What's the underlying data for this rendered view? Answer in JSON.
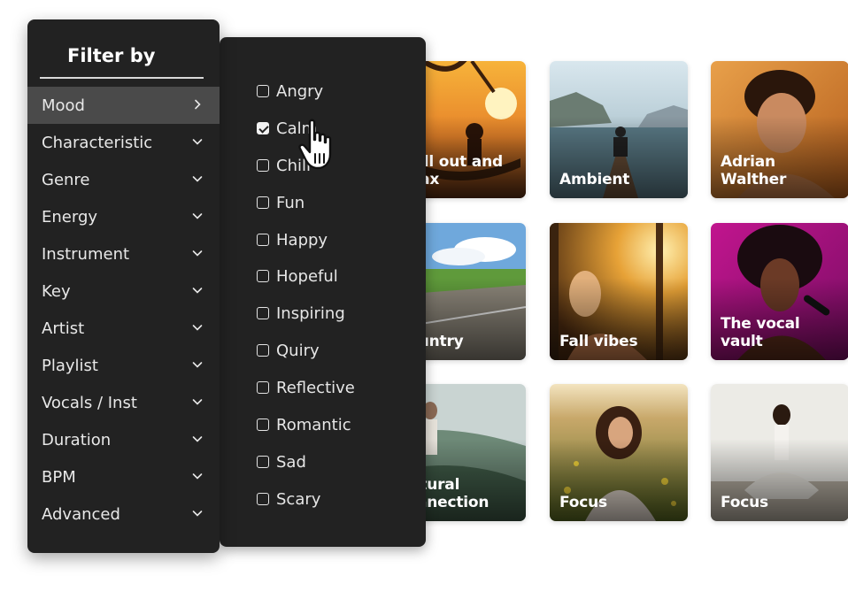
{
  "filter_panel": {
    "title": "Filter by",
    "items": [
      {
        "label": "Mood",
        "active": true,
        "chevron": "chevron-right-icon"
      },
      {
        "label": "Characteristic",
        "chevron": "chevron-down-icon"
      },
      {
        "label": "Genre",
        "chevron": "chevron-down-icon"
      },
      {
        "label": "Energy",
        "chevron": "chevron-down-icon"
      },
      {
        "label": "Instrument",
        "chevron": "chevron-down-icon"
      },
      {
        "label": "Key",
        "chevron": "chevron-down-icon"
      },
      {
        "label": "Artist",
        "chevron": "chevron-down-icon"
      },
      {
        "label": "Playlist",
        "chevron": "chevron-down-icon"
      },
      {
        "label": "Vocals / Inst",
        "chevron": "chevron-down-icon"
      },
      {
        "label": "Duration",
        "chevron": "chevron-down-icon"
      },
      {
        "label": "BPM",
        "chevron": "chevron-down-icon"
      },
      {
        "label": "Advanced",
        "chevron": "chevron-down-icon"
      }
    ]
  },
  "mood_options": [
    {
      "label": "Angry",
      "checked": false
    },
    {
      "label": "Calm",
      "checked": true
    },
    {
      "label": "Chill",
      "checked": false
    },
    {
      "label": "Fun",
      "checked": false
    },
    {
      "label": "Happy",
      "checked": false
    },
    {
      "label": "Hopeful",
      "checked": false
    },
    {
      "label": "Inspiring",
      "checked": false
    },
    {
      "label": "Quiry",
      "checked": false
    },
    {
      "label": "Reflective",
      "checked": false
    },
    {
      "label": "Romantic",
      "checked": false
    },
    {
      "label": "Sad",
      "checked": false
    },
    {
      "label": "Scary",
      "checked": false
    }
  ],
  "tiles": [
    {
      "title": "Chill out and\nrelax"
    },
    {
      "title": "Ambient"
    },
    {
      "title": "Adrian\nWalther"
    },
    {
      "title": "Country"
    },
    {
      "title": "Fall vibes"
    },
    {
      "title": "The vocal\nvault"
    },
    {
      "title": "Natural\nconnection"
    },
    {
      "title": "Focus"
    },
    {
      "title": "Focus"
    }
  ],
  "colors": {
    "panel_bg": "#222222",
    "active_row": "#4a4a4a",
    "text": "#e8e8e8"
  },
  "cursor": "hand-pointer-icon"
}
